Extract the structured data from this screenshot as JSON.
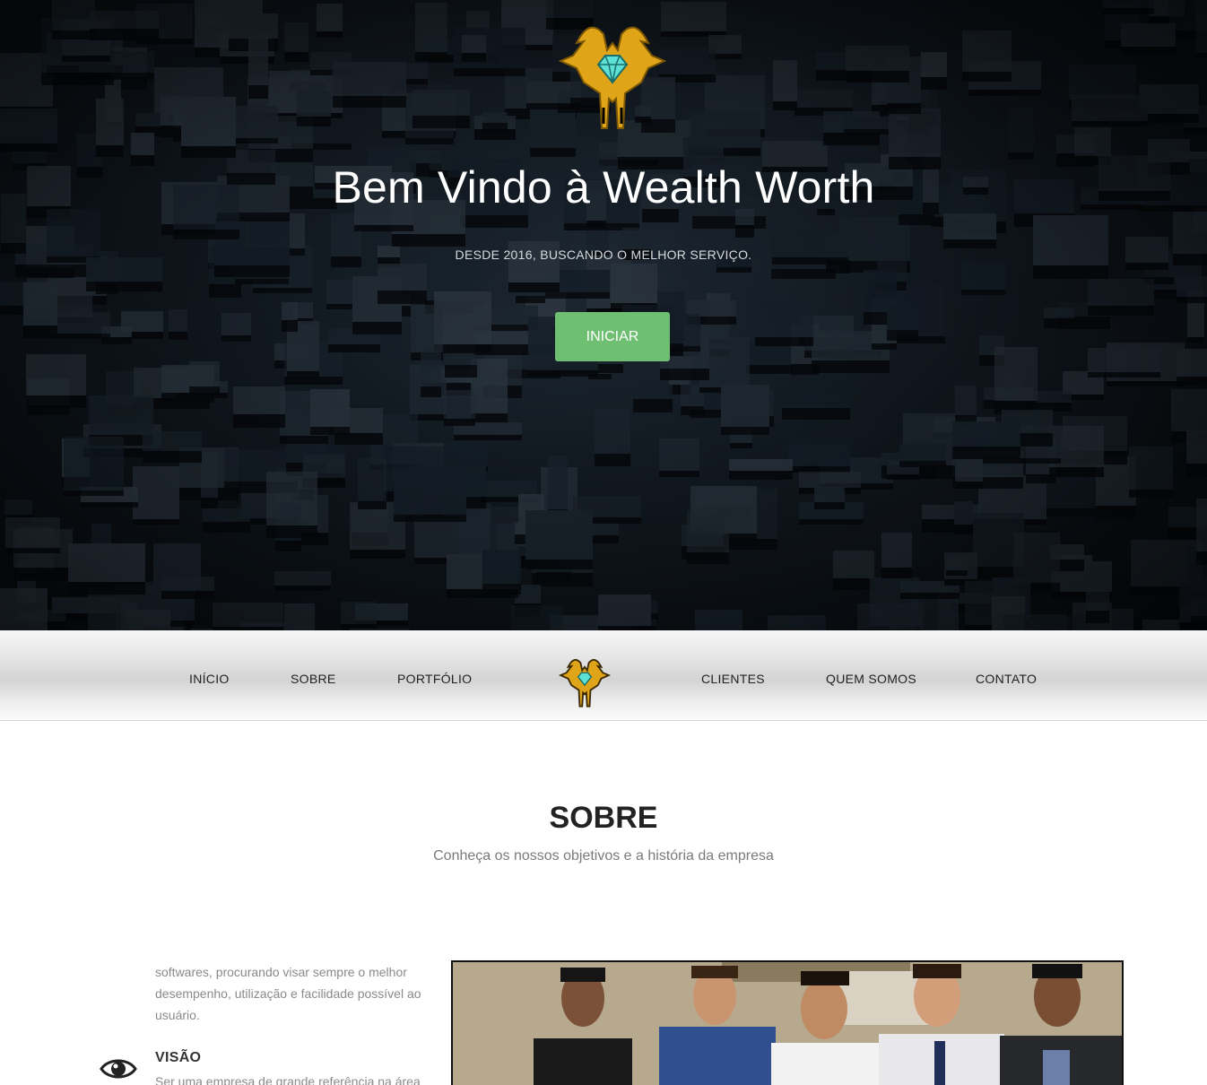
{
  "hero": {
    "title": "Bem Vindo à Wealth Worth",
    "subtitle": "DESDE 2016, BUSCANDO O MELHOR SERVIÇO.",
    "button_label": "INICIAR",
    "logo_icon": "diamond-crest-logo"
  },
  "nav": {
    "items": [
      "INÍCIO",
      "SOBRE",
      "PORTFÓLIO",
      "CLIENTES",
      "QUEM SOMOS",
      "CONTATO"
    ],
    "logo_icon": "diamond-crest-logo"
  },
  "about": {
    "title": "SOBRE",
    "subtitle": "Conheça os nossos objetivos e a história da empresa",
    "mission_text": "softwares, procurando visar sempre o melhor desempenho, utilização e facilidade possível ao usuário.",
    "vision_icon": "eye-icon",
    "vision_title": "VISÃO",
    "vision_text": "Ser uma empresa de grande referência na área"
  },
  "colors": {
    "accent_green": "#6fbf73",
    "logo_gold": "#e0a418",
    "diamond_cyan": "#5fe0d6",
    "hero_dark": "#121a22"
  }
}
